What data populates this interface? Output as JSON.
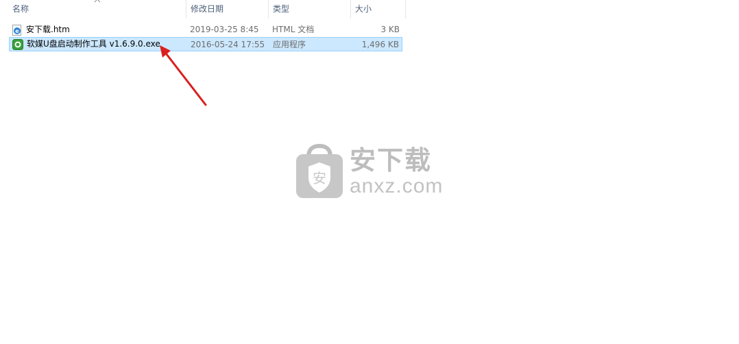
{
  "columns": {
    "name": "名称",
    "date": "修改日期",
    "type": "类型",
    "size": "大小"
  },
  "files": [
    {
      "name": "安下载.htm",
      "date": "2019-03-25 8:45",
      "type": "HTML 文档",
      "size": "3 KB",
      "icon": "html-document-icon",
      "selected": false
    },
    {
      "name": "软媒U盘启动制作工具 v1.6.9.0.exe",
      "date": "2016-05-24 17:55",
      "type": "应用程序",
      "size": "1,496 KB",
      "icon": "application-icon",
      "selected": true
    }
  ],
  "watermark": {
    "cn": "安下载",
    "en": "anxz.com",
    "badge": "安"
  },
  "colors": {
    "selection_bg": "#cce8ff",
    "selection_border": "#99d1ff",
    "arrow": "#d9201f",
    "header_text": "#4c607a"
  }
}
